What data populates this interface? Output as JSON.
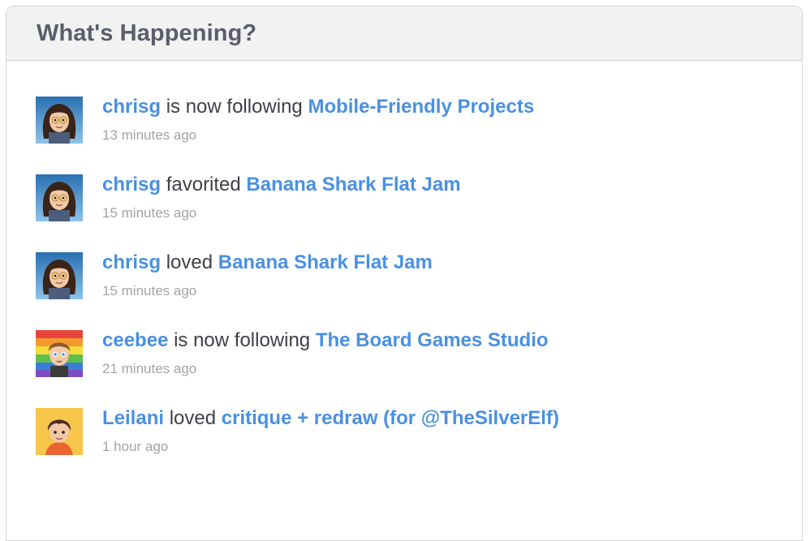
{
  "header": {
    "title": "What's Happening?"
  },
  "feed": {
    "items": [
      {
        "user": "chrisg",
        "action": " is now following ",
        "target": "Mobile-Friendly Projects",
        "time": "13 minutes ago",
        "avatar": "chrisg-avatar-icon"
      },
      {
        "user": "chrisg",
        "action": " favorited ",
        "target": "Banana Shark Flat Jam",
        "time": "15 minutes ago",
        "avatar": "chrisg-avatar-icon"
      },
      {
        "user": "chrisg",
        "action": " loved ",
        "target": "Banana Shark Flat Jam",
        "time": "15 minutes ago",
        "avatar": "chrisg-avatar-icon"
      },
      {
        "user": "ceebee",
        "action": " is now following ",
        "target": "The Board Games Studio",
        "time": "21 minutes ago",
        "avatar": "ceebee-avatar-icon"
      },
      {
        "user": "Leilani",
        "action": " loved ",
        "target": "critique + redraw (for @TheSilverElf)",
        "time": "1 hour ago",
        "avatar": "leilani-avatar-icon"
      }
    ]
  },
  "colors": {
    "link": "#4a90e2",
    "text": "#3f4048",
    "muted": "#a3a3a3",
    "header_bg": "#f2f2f2",
    "title": "#5a5d6b"
  }
}
